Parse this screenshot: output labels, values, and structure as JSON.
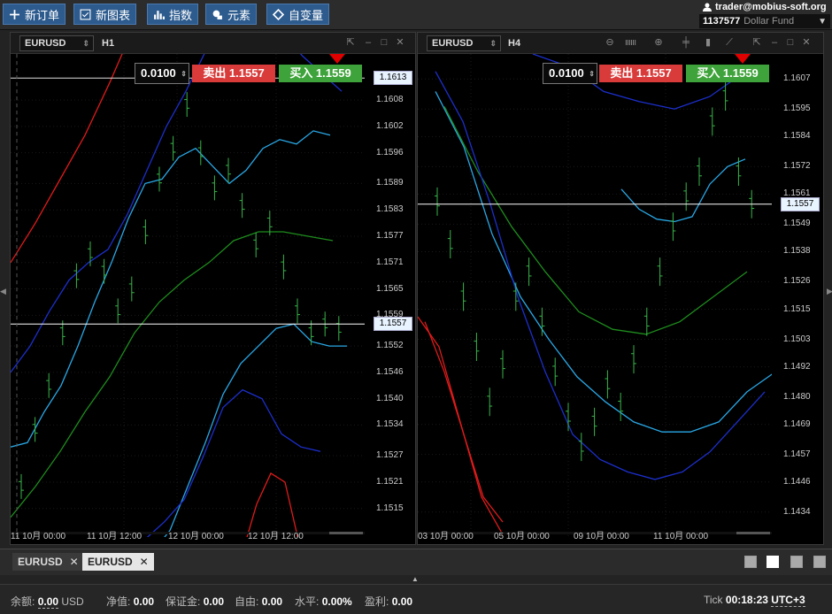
{
  "toolbar": {
    "new_order": "新订单",
    "new_chart": "新图表",
    "indicators": "指数",
    "objects": "元素",
    "variables": "自变量"
  },
  "account": {
    "user": "trader@mobius-soft.org",
    "number": "1137577",
    "fund": "Dollar Fund"
  },
  "colors": {
    "sell": "#d93b3b",
    "buy": "#3ea33a",
    "bars": "#39b54a",
    "band_outer": "#1c2fcc",
    "band_mid": "#29a8e6",
    "ma": "#1e8c1e",
    "upper_red": "#e01b1b"
  },
  "charts": [
    {
      "symbol": "EURUSD",
      "timeframe": "H1",
      "lot": "0.0100",
      "sell": "卖出 1.1557",
      "buy": "买入 1.1559",
      "price_tags": [
        "1.1613",
        "1.1557"
      ],
      "chart_data": {
        "type": "bar",
        "ylim": [
          1.15085,
          1.16185
        ],
        "y_ticks": [
          "1.1608",
          "1.1602",
          "1.1596",
          "1.1589",
          "1.1583",
          "1.1577",
          "1.1571",
          "1.1565",
          "1.1559",
          "1.1552",
          "1.1546",
          "1.1540",
          "1.1534",
          "1.1527",
          "1.1521",
          "1.1515"
        ],
        "x_ticks": [
          "11 10月 00:00",
          "11 10月 12:00",
          "12 10月 00:00",
          "12 10月 12:00"
        ],
        "current_price": 1.1557,
        "crosshair_price": 1.1613,
        "upper_red": [
          1.1571,
          1.158,
          1.159,
          1.16,
          1.1612,
          1.1625
        ],
        "band_outer_upper": [
          1.1546,
          1.1552,
          1.156,
          1.1567,
          1.1571,
          1.1574,
          1.1582,
          1.1592,
          1.1602,
          1.161,
          1.1619,
          1.1625,
          1.1628,
          1.1627,
          1.1623,
          1.1618,
          1.1614,
          1.161
        ],
        "band_mid_upper": [
          1.1529,
          1.153,
          1.1537,
          1.1543,
          1.1552,
          1.1562,
          1.1571,
          1.1581,
          1.1589,
          1.159,
          1.1595,
          1.1597,
          1.1593,
          1.1589,
          1.1592,
          1.1597,
          1.1599,
          1.1598,
          1.1601,
          1.16
        ],
        "ma": [
          1.1513,
          1.152,
          1.1528,
          1.1537,
          1.1545,
          1.1555,
          1.1562,
          1.1567,
          1.1571,
          1.1576,
          1.1578,
          1.1578,
          1.1577,
          1.1576
        ],
        "band_mid_lower": [
          1.1505,
          1.151,
          1.152,
          1.153,
          1.1541,
          1.1548,
          1.1552,
          1.1556,
          1.1557,
          1.1553,
          1.1552,
          1.1552
        ],
        "band_outer_lower": [
          1.1506,
          1.1508,
          1.1512,
          1.1517,
          1.1527,
          1.1538,
          1.1542,
          1.154,
          1.1532,
          1.1529,
          1.1528
        ],
        "lower_red": [
          1.1505,
          1.1516,
          1.1523,
          1.1521,
          1.1507
        ],
        "bars": [
          1.152,
          1.1533,
          1.1543,
          1.1555,
          1.1568,
          1.1573,
          1.1569,
          1.156,
          1.1565,
          1.1578,
          1.159,
          1.1597,
          1.1607,
          1.1596,
          1.1588,
          1.1592,
          1.1584,
          1.1575,
          1.158,
          1.157,
          1.156,
          1.1555,
          1.1557,
          1.1556
        ]
      }
    },
    {
      "symbol": "EURUSD",
      "timeframe": "H4",
      "lot": "0.0100",
      "sell": "卖出 1.1557",
      "buy": "买入 1.1559",
      "price_tags": [
        "1.1557"
      ],
      "chart_data": {
        "type": "bar",
        "ylim": [
          1.1424,
          1.1617
        ],
        "y_ticks": [
          "1.1607",
          "1.1595",
          "1.1584",
          "1.1572",
          "1.1561",
          "1.1549",
          "1.1538",
          "1.1526",
          "1.1515",
          "1.1503",
          "1.1492",
          "1.1480",
          "1.1469",
          "1.1457",
          "1.1446",
          "1.1434"
        ],
        "x_ticks": [
          "03 10月 00:00",
          "05 10月 00:00",
          "09 10月 00:00",
          "11 10月 00:00"
        ],
        "current_price": 1.1557,
        "upper_red": [
          1.1512,
          1.15,
          1.147,
          1.144,
          1.1425
        ],
        "band_outer_upper": [
          1.1617,
          1.1612,
          1.1602,
          1.1598,
          1.1595,
          1.16,
          1.161
        ],
        "band_mid_upper": [
          1.1602,
          1.158,
          1.1545,
          1.152,
          1.1503,
          1.1488,
          1.1478,
          1.147,
          1.1466,
          1.1466,
          1.147,
          1.1482,
          1.149
        ],
        "ma": [
          1.1596,
          1.157,
          1.1548,
          1.153,
          1.1514,
          1.1507,
          1.1505,
          1.151,
          1.152,
          1.153
        ],
        "band_mid_lower": [
          1.1563,
          1.1555,
          1.1551,
          1.155,
          1.1552,
          1.1565,
          1.1572,
          1.1575
        ],
        "band_outer_lower": [
          1.161,
          1.159,
          1.1557,
          1.152,
          1.149,
          1.1465,
          1.1455,
          1.145,
          1.1447,
          1.145,
          1.1458,
          1.147,
          1.1482
        ],
        "lower_red": [
          1.151,
          1.149,
          1.1465,
          1.144,
          1.143
        ],
        "bars": [
          1.1558,
          1.1541,
          1.152,
          1.15,
          1.1478,
          1.1493,
          1.152,
          1.153,
          1.151,
          1.149,
          1.1472,
          1.146,
          1.147,
          1.1485,
          1.1476,
          1.1495,
          1.151,
          1.153,
          1.1548,
          1.156,
          1.157,
          1.159,
          1.16,
          1.157,
          1.1557
        ]
      }
    }
  ],
  "tabs": [
    "EURUSD",
    "EURUSD"
  ],
  "status": {
    "balance_label": "余额:",
    "balance": "0.00",
    "currency": "USD",
    "equity_label": "净值:",
    "equity": "0.00",
    "margin_label": "保证金:",
    "margin": "0.00",
    "free_label": "自由:",
    "free": "0.00",
    "level_label": "水平:",
    "level": "0.00%",
    "profit_label": "盈利:",
    "profit": "0.00",
    "tick_label": "Tick",
    "time": "00:18:23",
    "timezone": "UTC+3"
  }
}
